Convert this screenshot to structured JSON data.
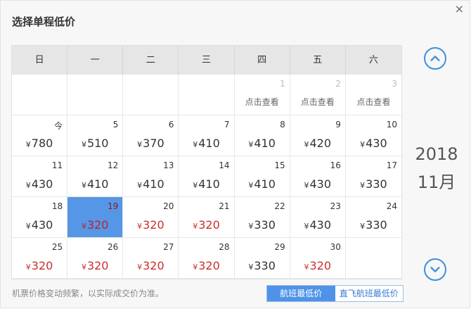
{
  "dialog": {
    "title": "选择单程低价",
    "close_label": "×"
  },
  "weekdays": [
    "日",
    "一",
    "二",
    "三",
    "四",
    "五",
    "六"
  ],
  "month_nav": {
    "year": "2018",
    "month": "11月",
    "prev_icon": "chevron-up-icon",
    "next_icon": "chevron-down-icon"
  },
  "calendar_cells": [
    {
      "blank": true
    },
    {
      "blank": true
    },
    {
      "blank": true
    },
    {
      "blank": true
    },
    {
      "day": "1",
      "view": "点击查看"
    },
    {
      "day": "2",
      "view": "点击查看"
    },
    {
      "day": "3",
      "view": "点击查看"
    },
    {
      "day": "今",
      "price": "780"
    },
    {
      "day": "5",
      "price": "510"
    },
    {
      "day": "6",
      "price": "370"
    },
    {
      "day": "7",
      "price": "410"
    },
    {
      "day": "8",
      "price": "410"
    },
    {
      "day": "9",
      "price": "420"
    },
    {
      "day": "10",
      "price": "430"
    },
    {
      "day": "11",
      "price": "430"
    },
    {
      "day": "12",
      "price": "410"
    },
    {
      "day": "13",
      "price": "410"
    },
    {
      "day": "14",
      "price": "410"
    },
    {
      "day": "15",
      "price": "410"
    },
    {
      "day": "16",
      "price": "430"
    },
    {
      "day": "17",
      "price": "330"
    },
    {
      "day": "18",
      "price": "430"
    },
    {
      "day": "19",
      "price": "320",
      "low": true,
      "selected": true
    },
    {
      "day": "20",
      "price": "320",
      "low": true
    },
    {
      "day": "21",
      "price": "320",
      "low": true
    },
    {
      "day": "22",
      "price": "330"
    },
    {
      "day": "23",
      "price": "430"
    },
    {
      "day": "24",
      "price": "330"
    },
    {
      "day": "25",
      "price": "320",
      "low": true
    },
    {
      "day": "26",
      "price": "320",
      "low": true
    },
    {
      "day": "27",
      "price": "320",
      "low": true
    },
    {
      "day": "28",
      "price": "320",
      "low": true
    },
    {
      "day": "29",
      "price": "330"
    },
    {
      "day": "30",
      "price": "320",
      "low": true
    },
    {
      "blank": true
    }
  ],
  "currency_symbol": "¥",
  "footer": {
    "note": "机票价格变动频繁，以实际成交价为准。",
    "toggle": [
      "航班最低价",
      "直飞航班最低价"
    ]
  },
  "colors": {
    "accent": "#3b8fe0",
    "selected_bg": "#5596e6",
    "low_price": "#cc2e2e"
  }
}
